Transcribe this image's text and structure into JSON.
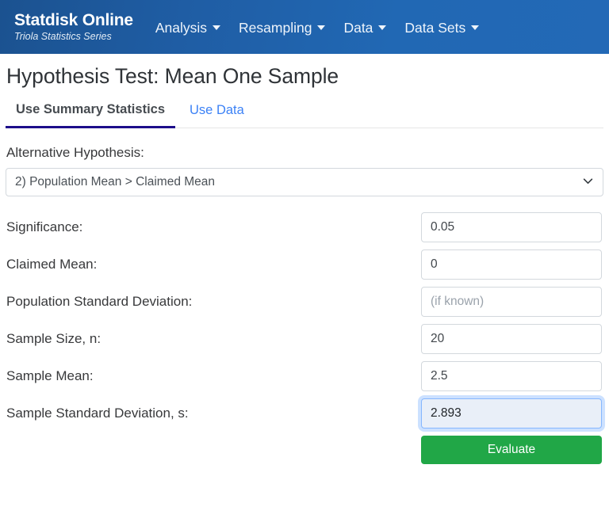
{
  "navbar": {
    "brand_title": "Statdisk Online",
    "brand_subtitle": "Triola Statistics Series",
    "background_color": "#1f5da4",
    "items": [
      {
        "label": "Analysis",
        "icon": "caret-down-icon"
      },
      {
        "label": "Resampling",
        "icon": "caret-down-icon"
      },
      {
        "label": "Data",
        "icon": "caret-down-icon"
      },
      {
        "label": "Data Sets",
        "icon": "caret-down-icon"
      }
    ]
  },
  "page": {
    "title": "Hypothesis Test: Mean One Sample"
  },
  "tabs": {
    "active_underline_color": "#1d0d8a",
    "link_color": "#3c82f6",
    "items": [
      {
        "label": "Use Summary Statistics",
        "active": true
      },
      {
        "label": "Use Data",
        "active": false
      }
    ]
  },
  "form": {
    "alternative_hypothesis": {
      "label": "Alternative Hypothesis:",
      "selected": "2) Population Mean > Claimed Mean",
      "chevron": "chevron-down-icon"
    },
    "fields": [
      {
        "label": "Significance:",
        "value": "0.05",
        "placeholder": "",
        "focused": false
      },
      {
        "label": "Claimed Mean:",
        "value": "0",
        "placeholder": "",
        "focused": false
      },
      {
        "label": "Population Standard Deviation:",
        "value": "",
        "placeholder": "(if known)",
        "focused": false
      },
      {
        "label": "Sample Size, n:",
        "value": "20",
        "placeholder": "",
        "focused": false
      },
      {
        "label": "Sample Mean:",
        "value": "2.5",
        "placeholder": "",
        "focused": false
      },
      {
        "label": "Sample Standard Deviation, s:",
        "value": "2.893",
        "placeholder": "",
        "focused": true
      }
    ],
    "evaluate_button": {
      "label": "Evaluate",
      "color": "#21a747"
    }
  }
}
